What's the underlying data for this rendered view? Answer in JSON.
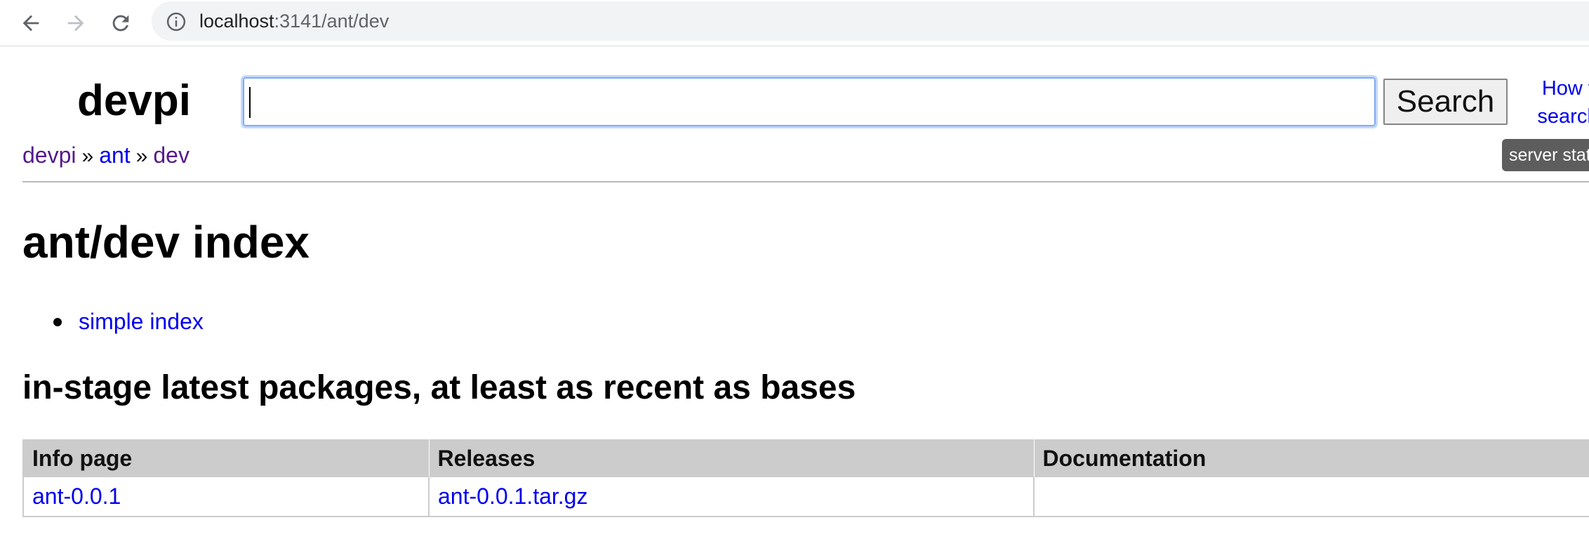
{
  "browser": {
    "url_host": "localhost",
    "url_path": ":3141/ant/dev",
    "icons": [
      "back-arrow-icon",
      "forward-arrow-icon",
      "reload-icon",
      "site-info-icon"
    ]
  },
  "header": {
    "logo": "devpi",
    "search_button": "Search",
    "howto_line1": "How to",
    "howto_line2": "search?",
    "server_status": "server status"
  },
  "breadcrumb": {
    "items": [
      "devpi",
      "ant",
      "dev"
    ],
    "separator": "»"
  },
  "main": {
    "title": "ant/dev index",
    "links": [
      "simple index"
    ],
    "section_title": "in-stage latest packages, at least as recent as bases",
    "table": {
      "headers": [
        "Info page",
        "Releases",
        "Documentation"
      ],
      "rows": [
        {
          "info": "ant-0.0.1",
          "release": "ant-0.0.1.tar.gz",
          "docs": ""
        }
      ]
    }
  },
  "colors": {
    "link": "#0000ee",
    "visited_link": "#551a8b",
    "table_header_bg": "#cccccc",
    "focus_ring": "#7eaaf7"
  }
}
